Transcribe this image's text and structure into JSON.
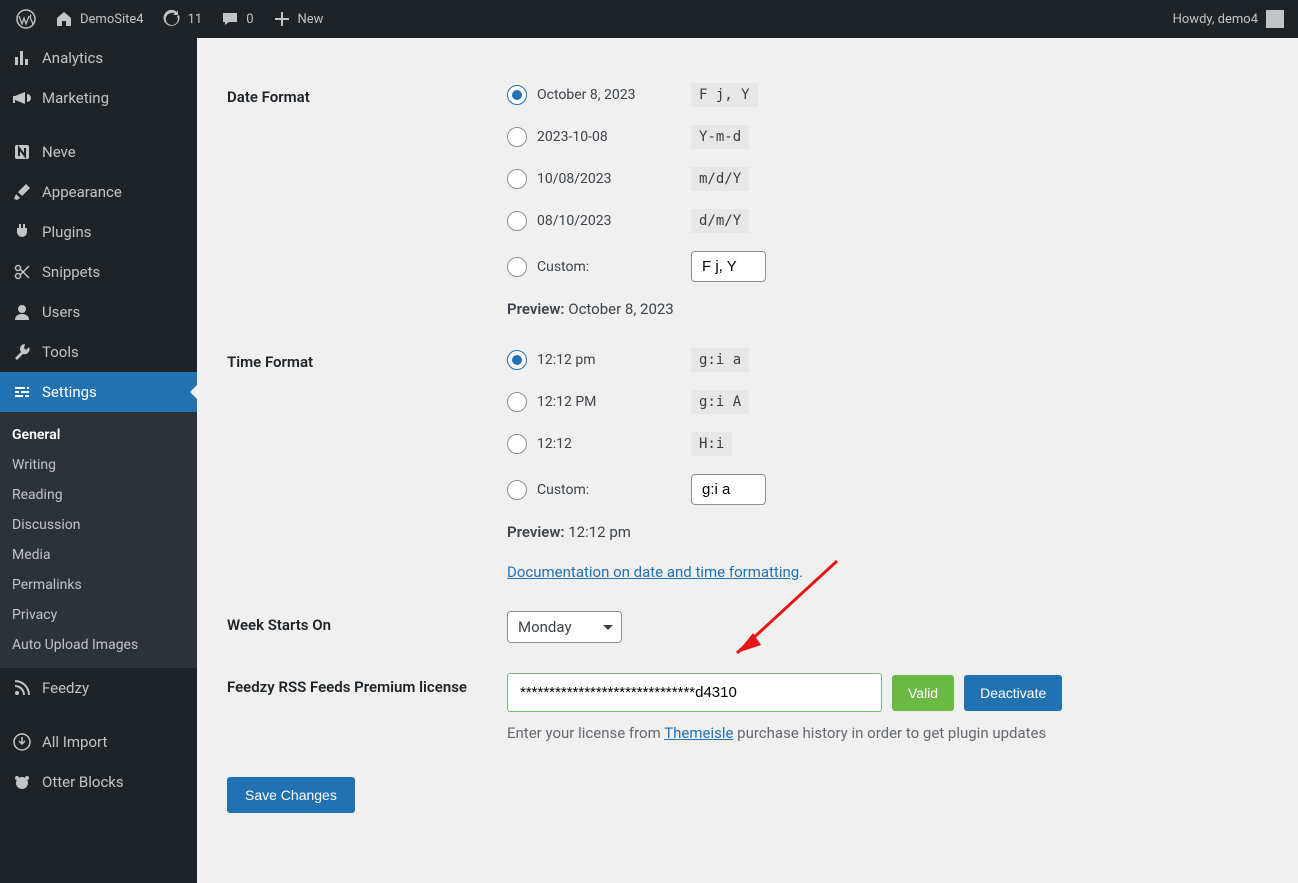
{
  "topbar": {
    "site": "DemoSite4",
    "updates": "11",
    "comments": "0",
    "new": "New",
    "howdy": "Howdy, demo4"
  },
  "sidebar": {
    "items": [
      {
        "label": "Analytics"
      },
      {
        "label": "Marketing"
      },
      {
        "label": "Neve"
      },
      {
        "label": "Appearance"
      },
      {
        "label": "Plugins"
      },
      {
        "label": "Snippets"
      },
      {
        "label": "Users"
      },
      {
        "label": "Tools"
      },
      {
        "label": "Settings"
      },
      {
        "label": "Feedzy"
      },
      {
        "label": "All Import"
      },
      {
        "label": "Otter Blocks"
      }
    ],
    "submenu": [
      {
        "label": "General"
      },
      {
        "label": "Writing"
      },
      {
        "label": "Reading"
      },
      {
        "label": "Discussion"
      },
      {
        "label": "Media"
      },
      {
        "label": "Permalinks"
      },
      {
        "label": "Privacy"
      },
      {
        "label": "Auto Upload Images"
      }
    ]
  },
  "date_format": {
    "heading": "Date Format",
    "opts": [
      {
        "label": "October 8, 2023",
        "code": "F j, Y"
      },
      {
        "label": "2023-10-08",
        "code": "Y-m-d"
      },
      {
        "label": "10/08/2023",
        "code": "m/d/Y"
      },
      {
        "label": "08/10/2023",
        "code": "d/m/Y"
      }
    ],
    "custom": "Custom:",
    "custom_value": "F j, Y",
    "preview_label": "Preview:",
    "preview_value": "October 8, 2023"
  },
  "time_format": {
    "heading": "Time Format",
    "opts": [
      {
        "label": "12:12 pm",
        "code": "g:i a"
      },
      {
        "label": "12:12 PM",
        "code": "g:i A"
      },
      {
        "label": "12:12",
        "code": "H:i"
      }
    ],
    "custom": "Custom:",
    "custom_value": "g:i a",
    "preview_label": "Preview:",
    "preview_value": "12:12 pm",
    "doc_link": "Documentation on date and time formatting"
  },
  "week": {
    "heading": "Week Starts On",
    "value": "Monday"
  },
  "license": {
    "heading": "Feedzy RSS Feeds Premium license",
    "value": "******************************d4310",
    "valid": "Valid",
    "deactivate": "Deactivate",
    "desc_before": "Enter your license from ",
    "desc_link": "Themeisle",
    "desc_after": " purchase history in order to get plugin updates"
  },
  "save": "Save Changes"
}
